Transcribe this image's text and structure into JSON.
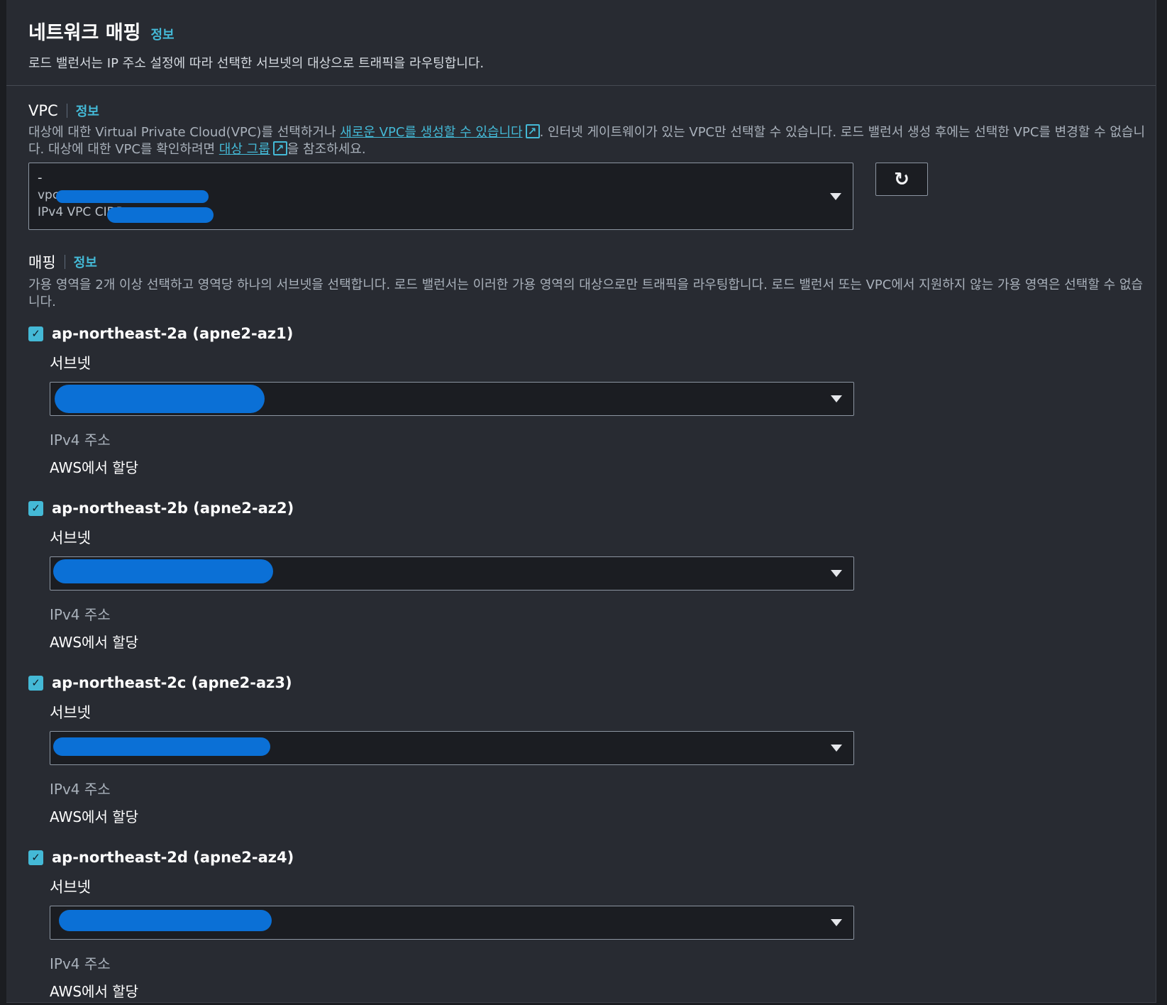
{
  "header": {
    "title": "네트워크 매핑",
    "info": "정보",
    "description": "로드 밸런서는 IP 주소 설정에 따라 선택한 서브넷의 대상으로 트래픽을 라우팅합니다."
  },
  "vpc": {
    "label": "VPC",
    "info": "정보",
    "desc_part1": "대상에 대한 Virtual Private Cloud(VPC)를 선택하거나 ",
    "create_link": "새로운 VPC를 생성할 수 있습니다",
    "desc_part2": ". 인터넷 게이트웨이가 있는 VPC만 선택할 수 있습니다. 로드 밸런서 생성 후에는 선택한 VPC를 변경할 수 없습니다. 대상에 대한 VPC를 확인하려면 ",
    "target_group_link": "대상 그룹",
    "desc_part3": "을 참조하세요.",
    "selected_name": "-",
    "selected_id": "vpc",
    "selected_cidr": "IPv4 VPC CIDR:"
  },
  "mapping": {
    "label": "매핑",
    "info": "정보",
    "description": "가용 영역을 2개 이상 선택하고 영역당 하나의 서브넷을 선택합니다. 로드 밸런서는 이러한 가용 영역의 대상으로만 트래픽을 라우팅합니다. 로드 밸런서 또는 VPC에서 지원하지 않는 가용 영역은 선택할 수 없습니다.",
    "zones": [
      {
        "name": "ap-northeast-2a (apne2-az1)",
        "checked": true,
        "subnet_label": "서브넷",
        "ip_label": "IPv4 주소",
        "ip_value": "AWS에서 할당"
      },
      {
        "name": "ap-northeast-2b (apne2-az2)",
        "checked": true,
        "subnet_label": "서브넷",
        "ip_label": "IPv4 주소",
        "ip_value": "AWS에서 할당"
      },
      {
        "name": "ap-northeast-2c (apne2-az3)",
        "checked": true,
        "subnet_label": "서브넷",
        "ip_label": "IPv4 주소",
        "ip_value": "AWS에서 할당"
      },
      {
        "name": "ap-northeast-2d (apne2-az4)",
        "checked": true,
        "subnet_label": "서브넷",
        "ip_label": "IPv4 주소",
        "ip_value": "AWS에서 할당"
      }
    ]
  },
  "icons": {
    "checkbox": "checkmark-icon",
    "external": "external-link-icon",
    "refresh": "refresh-icon",
    "caret": "caret-down-icon"
  },
  "colors": {
    "accent": "#44b9d6",
    "panel_bg": "#282b32",
    "input_bg": "#1b1d22",
    "redaction": "#0b70d6"
  }
}
